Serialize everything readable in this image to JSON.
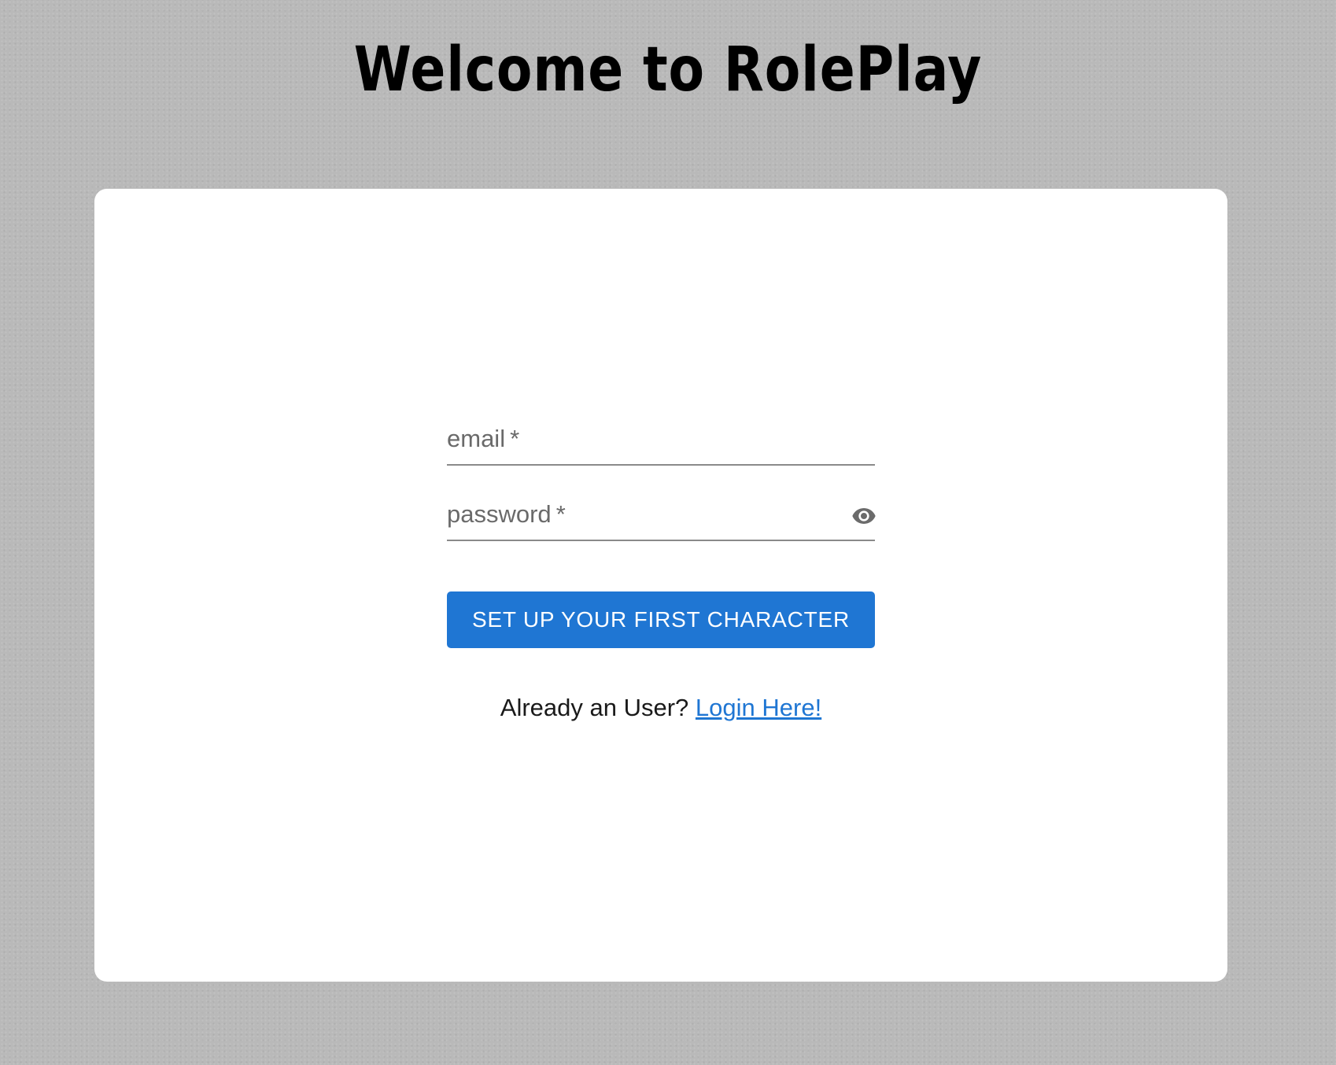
{
  "header": {
    "title": "Welcome to RolePlay"
  },
  "form": {
    "email_label": "email",
    "password_label": "password",
    "required_marker": "*",
    "email_value": "",
    "password_value": "",
    "visibility_icon": "eye-icon",
    "submit_label": "SET UP YOUR FIRST CHARACTER"
  },
  "footer": {
    "prompt": "Already an User?",
    "link_label": "Login Here!"
  },
  "colors": {
    "background": "#b9b9b9",
    "card": "#ffffff",
    "accent": "#1f76d3",
    "label": "#6a6a6a",
    "underline": "#8a8a8a"
  }
}
